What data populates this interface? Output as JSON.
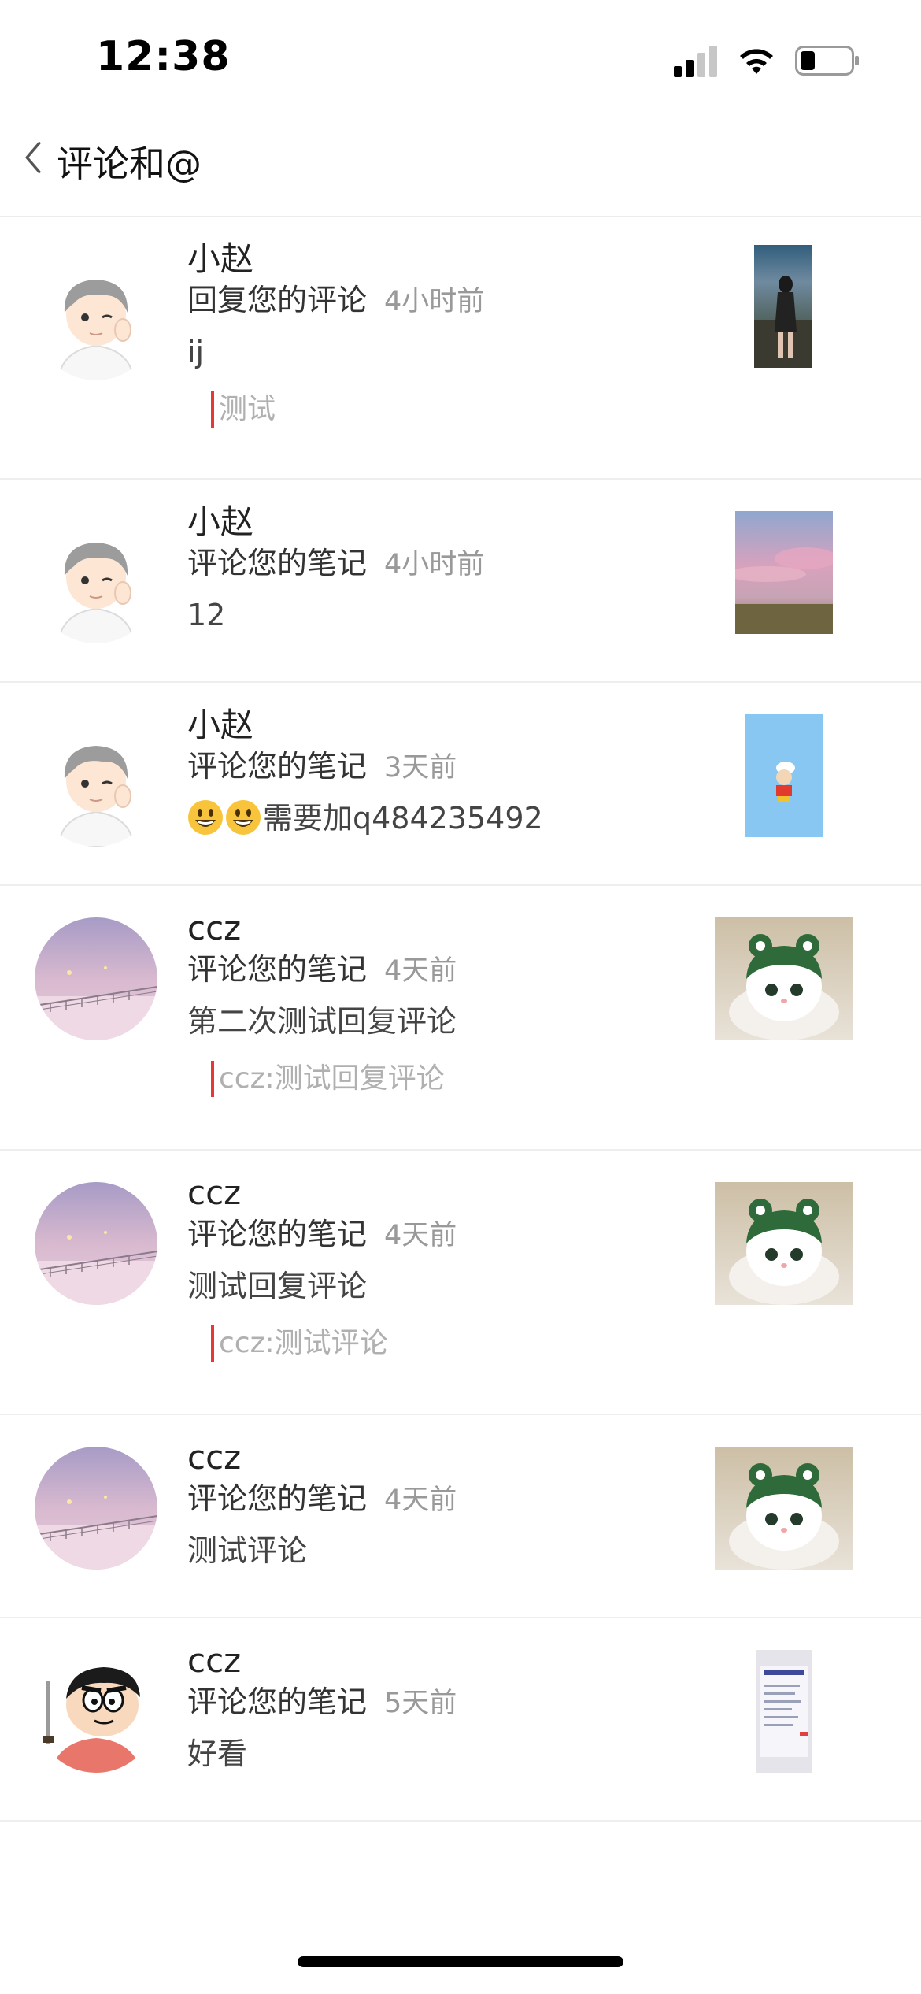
{
  "status_bar": {
    "time": "12:38",
    "signal_icon": "cellular-signal-icon",
    "wifi_icon": "wifi-icon",
    "battery_icon": "battery-low-icon"
  },
  "nav": {
    "back_icon": "chevron-left-icon",
    "title": "评论和@"
  },
  "colors": {
    "quote_bar": "#e53935",
    "time_text": "#999999",
    "divider": "#eeeeee"
  },
  "items": [
    {
      "username": "小赵",
      "action": "回复您的评论",
      "time": "4小时前",
      "comment": "ij",
      "quote": "测试",
      "avatar": "anime-boy-avatar",
      "thumbnail": "girl-on-beach-photo"
    },
    {
      "username": "小赵",
      "action": "评论您的笔记",
      "time": "4小时前",
      "comment": "12",
      "avatar": "anime-boy-avatar",
      "thumbnail": "pink-sky-landscape-photo"
    },
    {
      "username": "小赵",
      "action": "评论您的笔记",
      "time": "3天前",
      "comment_emoji": [
        "smiley-emoji",
        "smiley-emoji"
      ],
      "comment": "需要加q484235492",
      "avatar": "anime-boy-avatar",
      "thumbnail": "cartoon-character-blue-photo"
    },
    {
      "username": "ccz",
      "action": "评论您的笔记",
      "time": "4天前",
      "comment": "第二次测试回复评论",
      "quote": "ccz:测试回复评论",
      "avatar": "snowy-bridge-avatar",
      "thumbnail": "kitten-frog-hat-photo"
    },
    {
      "username": "ccz",
      "action": "评论您的笔记",
      "time": "4天前",
      "comment": "测试回复评论",
      "quote": "ccz:测试评论",
      "avatar": "snowy-bridge-avatar",
      "thumbnail": "kitten-frog-hat-photo"
    },
    {
      "username": "ccz",
      "action": "评论您的笔记",
      "time": "4天前",
      "comment": "测试评论",
      "avatar": "snowy-bridge-avatar",
      "thumbnail": "kitten-frog-hat-photo"
    },
    {
      "username": "ccz",
      "action": "评论您的笔记",
      "time": "5天前",
      "comment": "好看",
      "avatar": "cartoon-boy-avatar",
      "thumbnail": "document-screenshot-photo"
    }
  ]
}
